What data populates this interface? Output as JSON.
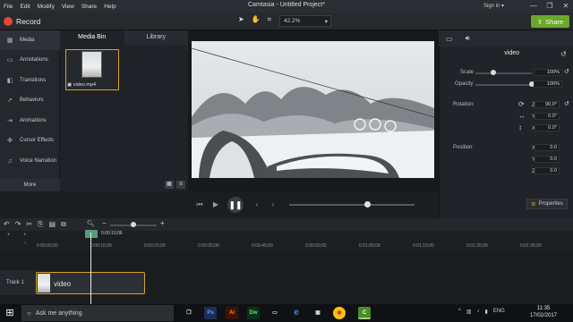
{
  "menu": [
    "File",
    "Edit",
    "Modify",
    "View",
    "Share",
    "Help"
  ],
  "window_title": "Camtasia - Untitled Project*",
  "sign_in": "Sign in ▾",
  "window_controls": [
    "—",
    "❐",
    "✕"
  ],
  "record_label": "Record",
  "zoom": "42.2%",
  "share_label": "Share",
  "sidebar": [
    {
      "label": "Media",
      "icon": "media-icon",
      "glyph": "▦"
    },
    {
      "label": "Annotations",
      "icon": "annotations-icon",
      "glyph": "▭"
    },
    {
      "label": "Transitions",
      "icon": "transitions-icon",
      "glyph": "◧"
    },
    {
      "label": "Behaviors",
      "icon": "behaviors-icon",
      "glyph": "➚"
    },
    {
      "label": "Animations",
      "icon": "animations-icon",
      "glyph": "⇥"
    },
    {
      "label": "Cursor Effects",
      "icon": "cursor-effects-icon",
      "glyph": "✜"
    },
    {
      "label": "Voice Narration",
      "icon": "microphone-icon",
      "glyph": "♫"
    }
  ],
  "more_label": "More",
  "bin_tabs": [
    "Media Bin",
    "Library"
  ],
  "clip_name": "video.mp4",
  "properties": {
    "title": "video",
    "scale_label": "Scale",
    "scale_value": "100%",
    "scale_fraction": 0.32,
    "opacity_label": "Opacity",
    "opacity_value": "100%",
    "opacity_fraction": 1.0,
    "rotation_label": "Rotation:",
    "rot_z": "90.0°",
    "rot_y": "0.0°",
    "rot_x": "0.0°",
    "position_label": "Position:",
    "pos_x": "0.0",
    "pos_y": "0.0",
    "pos_z": "0.0",
    "button_label": "Properties"
  },
  "playback_fraction": 0.62,
  "timeline": {
    "playhead_time": "0:00:10;06",
    "ticks": [
      "0:00:00;00",
      "0:00:10;00",
      "0:00:20;00",
      "0:00:30;00",
      "0:00:40;00",
      "0:00:50;00",
      "0:01:00;00",
      "0:01:10;00",
      "0:01:20;00",
      "0:01:30;00"
    ],
    "track_label": "Track 1",
    "clip_label": "video"
  },
  "taskbar": {
    "search_placeholder": "Ask me anything",
    "time": "11:35",
    "date": "17/02/2017",
    "lang": "ENG"
  }
}
